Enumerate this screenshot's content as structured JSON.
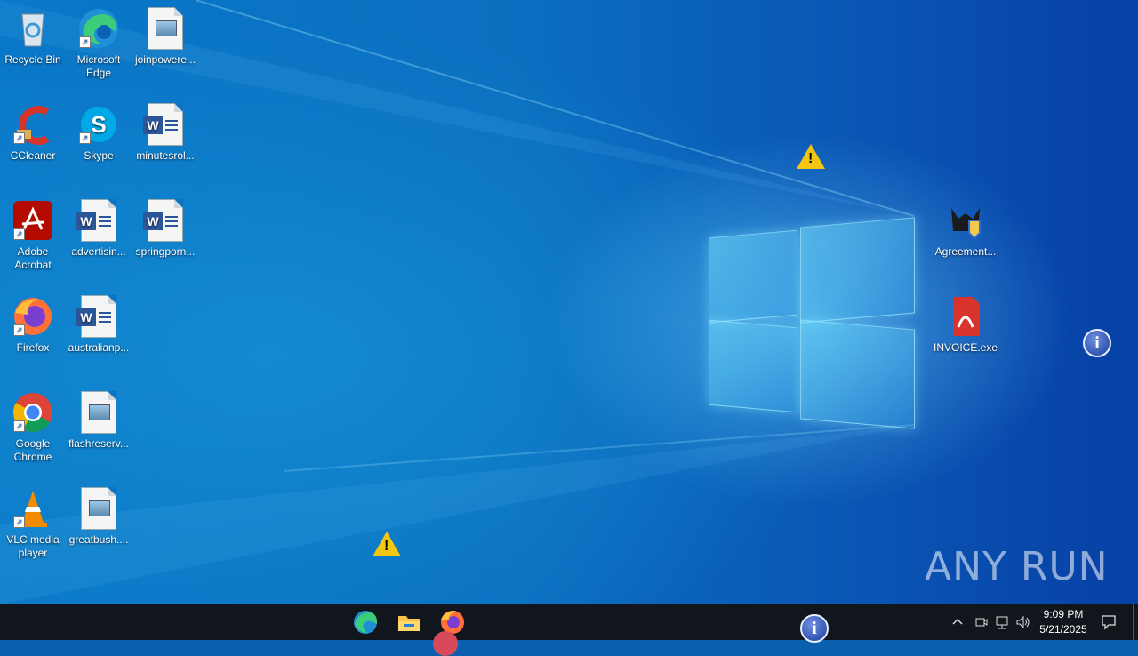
{
  "desktop": {
    "icons": [
      {
        "label": "Recycle Bin",
        "icon": "recycle-bin-icon"
      },
      {
        "label": "Microsoft Edge",
        "icon": "edge-icon"
      },
      {
        "label": "joinpowere...",
        "icon": "image-file-icon"
      },
      {
        "label": "CCleaner",
        "icon": "ccleaner-icon"
      },
      {
        "label": "Skype",
        "icon": "skype-icon"
      },
      {
        "label": "minutesrol...",
        "icon": "word-document-icon"
      },
      {
        "label": "Adobe Acrobat",
        "icon": "acrobat-icon"
      },
      {
        "label": "advertisin...",
        "icon": "word-document-icon"
      },
      {
        "label": "springporn...",
        "icon": "word-document-icon"
      },
      {
        "label": "Firefox",
        "icon": "firefox-icon"
      },
      {
        "label": "australianp...",
        "icon": "word-document-icon"
      },
      {
        "label": "Google Chrome",
        "icon": "chrome-icon"
      },
      {
        "label": "flashreserv...",
        "icon": "image-file-icon"
      },
      {
        "label": "VLC media player",
        "icon": "vlc-icon"
      },
      {
        "label": "greatbush....",
        "icon": "image-file-icon"
      },
      {
        "label": "Agreement...",
        "icon": "agreement-exe-icon"
      },
      {
        "label": "INVOICE.exe",
        "icon": "invoice-exe-icon"
      }
    ]
  },
  "watermark": "ANY RUN",
  "taskbar": {
    "apps": [
      "edge-icon",
      "file-explorer-icon",
      "firefox-icon"
    ],
    "tray_icons": [
      "chevron-up-icon",
      "meet-now-icon",
      "network-icon",
      "volume-icon"
    ],
    "time": "9:09 PM",
    "date": "5/21/2025",
    "notification_icon": "notification-center-icon"
  },
  "colors": {
    "warning": "#f3c613",
    "info": "#1b3f9e",
    "taskbar": "#10161c"
  }
}
